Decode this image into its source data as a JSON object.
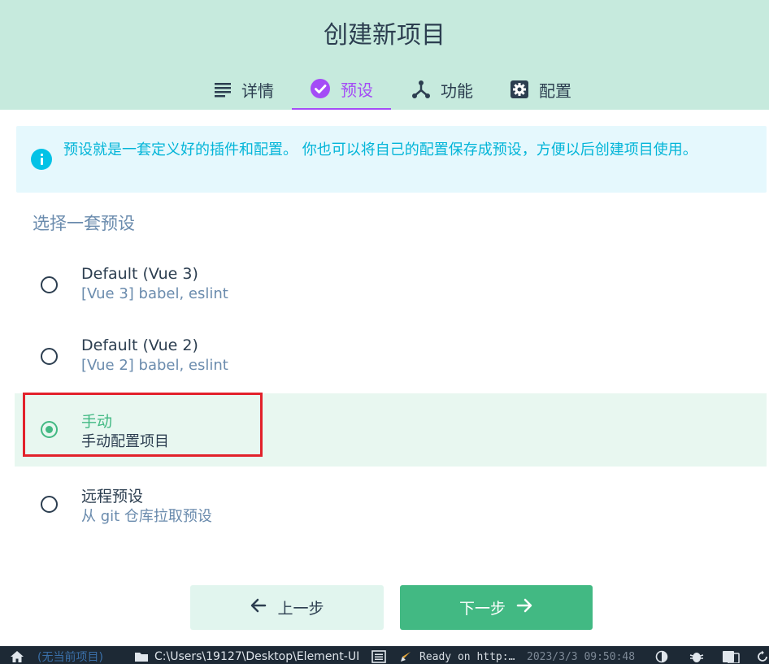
{
  "header": {
    "title": "创建新项目",
    "tabs": [
      {
        "label": "详情",
        "icon": "list-icon",
        "active": false
      },
      {
        "label": "预设",
        "icon": "check-circle-icon",
        "active": true
      },
      {
        "label": "功能",
        "icon": "fork-icon",
        "active": false
      },
      {
        "label": "配置",
        "icon": "gear-icon",
        "active": false
      }
    ]
  },
  "info": {
    "text": "预设就是一套定义好的插件和配置。 你也可以将自己的配置保存成预设，方便以后创建项目使用。"
  },
  "section_title": "选择一套预设",
  "presets": [
    {
      "name": "Default (Vue 3)",
      "description": "[Vue 3] babel, eslint",
      "selected": false
    },
    {
      "name": "Default (Vue 2)",
      "description": "[Vue 2] babel, eslint",
      "selected": false
    },
    {
      "name": "手动",
      "description": "手动配置项目",
      "selected": true
    },
    {
      "name": "远程预设",
      "description": "从 git 仓库拉取预设",
      "selected": false
    }
  ],
  "buttons": {
    "prev": "上一步",
    "next": "下一步"
  },
  "statusbar": {
    "project": "(无当前项目)",
    "path": "C:\\Users\\19127\\Desktop\\Element-UI",
    "log": "Ready on http:…",
    "time": "2023/3/3 09:50:48"
  },
  "colors": {
    "header_bg": "#c6eadd",
    "accent_purple": "#a44cf6",
    "accent_green": "#42b983",
    "info_bg": "#e5f8fd",
    "info_text": "#03b5d8",
    "highlight_red": "#e2212b",
    "statusbar_bg": "#1d2935"
  }
}
